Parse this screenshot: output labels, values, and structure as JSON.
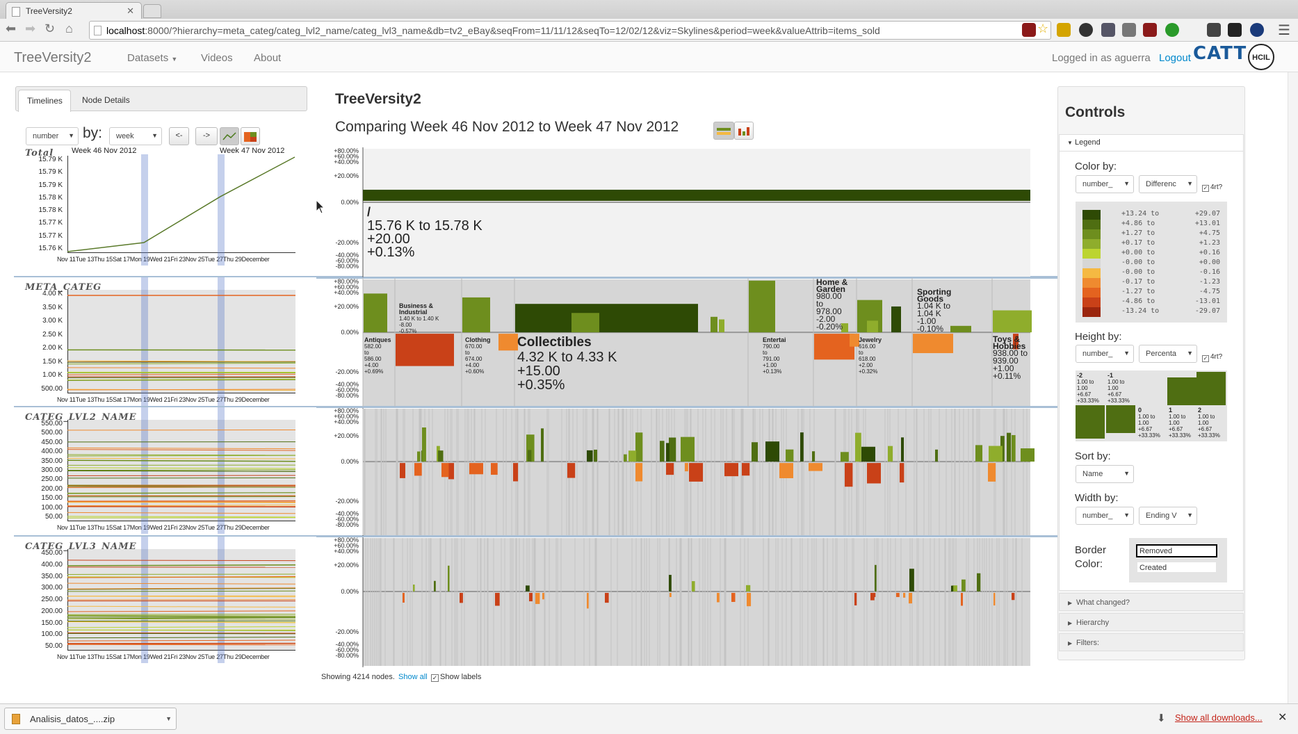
{
  "browser": {
    "tab_title": "TreeVersity2",
    "url_host": "localhost",
    "url_rest": ":8000/?hierarchy=meta_categ/categ_lvl2_name/categ_lvl3_name&db=tv2_eBay&seqFrom=11/11/12&seqTo=12/02/12&viz=Skylines&period=week&valueAttrib=items_sold"
  },
  "navbar": {
    "brand": "TreeVersity2",
    "links": [
      "Datasets",
      "Videos",
      "About"
    ],
    "login_text": "Logged in as aguerra",
    "logout": "Logout",
    "logo": "CATT"
  },
  "left": {
    "tabs": [
      "Timelines",
      "Node Details"
    ],
    "attr_select": "number",
    "by_label": "by:",
    "period_select": "week",
    "prev_btn": "<-",
    "next_btn": "->",
    "week_from": "Week 46 Nov 2012",
    "week_to": "Week 47 Nov 2012",
    "x_ticks": "Nov 11Tue 13Thu 15Sat 17Mon 19Wed 21Fri 23Nov 25Tue 27Thu 29December",
    "timelines": [
      {
        "title": "Total",
        "yticks": [
          "15.79 K",
          "15.79 K",
          "15.79 K",
          "15.78 K",
          "15.78 K",
          "15.77 K",
          "15.77 K",
          "15.76 K"
        ]
      },
      {
        "title": "META_CATEG",
        "yticks": [
          "4.00 K",
          "3.50 K",
          "3.00 K",
          "2.50 K",
          "2.00 K",
          "1.50 K",
          "1.00 K",
          "500.00"
        ]
      },
      {
        "title": "CATEG_LVL2_NAME",
        "yticks": [
          "550.00",
          "500.00",
          "450.00",
          "400.00",
          "350.00",
          "300.00",
          "250.00",
          "200.00",
          "150.00",
          "100.00",
          "50.00"
        ]
      },
      {
        "title": "CATEG_LVL3_NAME",
        "yticks": [
          "450.00",
          "400.00",
          "350.00",
          "300.00",
          "250.00",
          "200.00",
          "150.00",
          "100.00",
          "50.00"
        ]
      }
    ]
  },
  "center": {
    "title": "TreeVersity2",
    "subtitle": "Comparing Week 46 Nov 2012 to Week 47 Nov 2012",
    "footer_text": "Showing 4214 nodes.",
    "show_all": "Show all",
    "show_labels": "Show labels",
    "axis_top": [
      "+80.00%",
      "+60.00%",
      "+40.00%",
      "+20.00%"
    ],
    "axis_zero": "0.00%",
    "axis_bottom": [
      "-20.00%",
      "-40.00%",
      "-60.00%",
      "-80.00%"
    ],
    "root": {
      "name": "/",
      "range": "15.76 K to 15.78 K",
      "diff": "+20.00",
      "pct": "+0.13%"
    },
    "meta_nodes": [
      {
        "name": "Antiques",
        "lines": [
          "582.00",
          "to",
          "586.00",
          "+4.00",
          "+0.69%"
        ]
      },
      {
        "name": "Business & Industrial",
        "lines": [
          "1.40 K to 1.40 K",
          "-8.00",
          "-0.57%"
        ]
      },
      {
        "name": "Clothing, Shoes & Accessories",
        "lines": [
          "670.00",
          "to",
          "674.00",
          "+4.00",
          "+0.60%"
        ]
      },
      {
        "name": "Collectibles",
        "lines": [
          "4.32 K to 4.33 K",
          "+15.00",
          "+0.35%"
        ]
      },
      {
        "name": "Entertainment Memorabilia",
        "lines": [
          "790.00",
          "to",
          "791.00",
          "+1.00",
          "+0.13%"
        ]
      },
      {
        "name": "Home & Garden",
        "lines": [
          "980.00",
          "to",
          "978.00",
          "-2.00",
          "-0.20%"
        ]
      },
      {
        "name": "Jewelry & Watches",
        "lines": [
          "616.00",
          "to",
          "618.00",
          "+2.00",
          "+0.32%"
        ]
      },
      {
        "name": "Sporting Goods",
        "lines": [
          "1.04 K to",
          "1.04 K",
          "-1.00",
          "-0.10%"
        ]
      },
      {
        "name": "Toys & Hobbies",
        "lines": [
          "938.00 to",
          "939.00",
          "+1.00",
          "+0.11%"
        ]
      }
    ]
  },
  "controls": {
    "title": "Controls",
    "legend": "Legend",
    "color_by": "Color by:",
    "color_sel1": "number_",
    "color_sel2": "Differenc",
    "sqrt_label": "4rt?",
    "legend_ranges": [
      [
        "+13.24 to",
        "+29.07"
      ],
      [
        "+4.86 to",
        "+13.01"
      ],
      [
        "+1.27 to",
        "+4.75"
      ],
      [
        "+0.17 to",
        "+1.23"
      ],
      [
        "+0.00 to",
        "+0.16"
      ],
      [
        "-0.00 to",
        "+0.00"
      ],
      [
        "-0.00 to",
        "-0.16"
      ],
      [
        "-0.17 to",
        "-1.23"
      ],
      [
        "-1.27 to",
        "-4.75"
      ],
      [
        "-4.86 to",
        "-13.01"
      ],
      [
        "-13.24 to",
        "-29.07"
      ]
    ],
    "legend_colors": [
      "#2e4a05",
      "#4f6e12",
      "#6e8e1e",
      "#8fad2c",
      "#bcd430",
      "#d6d6d6",
      "#f5b942",
      "#ef8a2f",
      "#e4631f",
      "#c94118",
      "#9b260e"
    ],
    "height_by": "Height by:",
    "height_sel1": "number_",
    "height_sel2": "Percenta",
    "height_legend": [
      {
        "lbl": "-2",
        "lines": [
          "1.00 to",
          "1.00",
          "+6.67",
          "+33.33%"
        ]
      },
      {
        "lbl": "-1",
        "lines": [
          "1.00 to",
          "1.00",
          "+6.67",
          "+33.33%"
        ]
      },
      {
        "lbl": "0",
        "lines": [
          "1.00 to",
          "1.00",
          "+6.67",
          "+33.33%"
        ]
      },
      {
        "lbl": "1",
        "lines": [
          "1.00 to",
          "1.00",
          "+6.67",
          "+33.33%"
        ]
      },
      {
        "lbl": "2",
        "lines": [
          "1.00 to",
          "1.00",
          "+6.67",
          "+33.33%"
        ]
      }
    ],
    "sort_by": "Sort by:",
    "sort_sel": "Name",
    "width_by": "Width by:",
    "width_sel1": "number_",
    "width_sel2": "Ending V",
    "border_label1": "Border",
    "border_label2": "Color:",
    "border_removed": "Removed",
    "border_created": "Created",
    "accordions": [
      "What changed?",
      "Hierarchy",
      "Filters:"
    ]
  },
  "downloads": {
    "file": "Analisis_datos_....zip",
    "show_all": "Show all downloads..."
  }
}
